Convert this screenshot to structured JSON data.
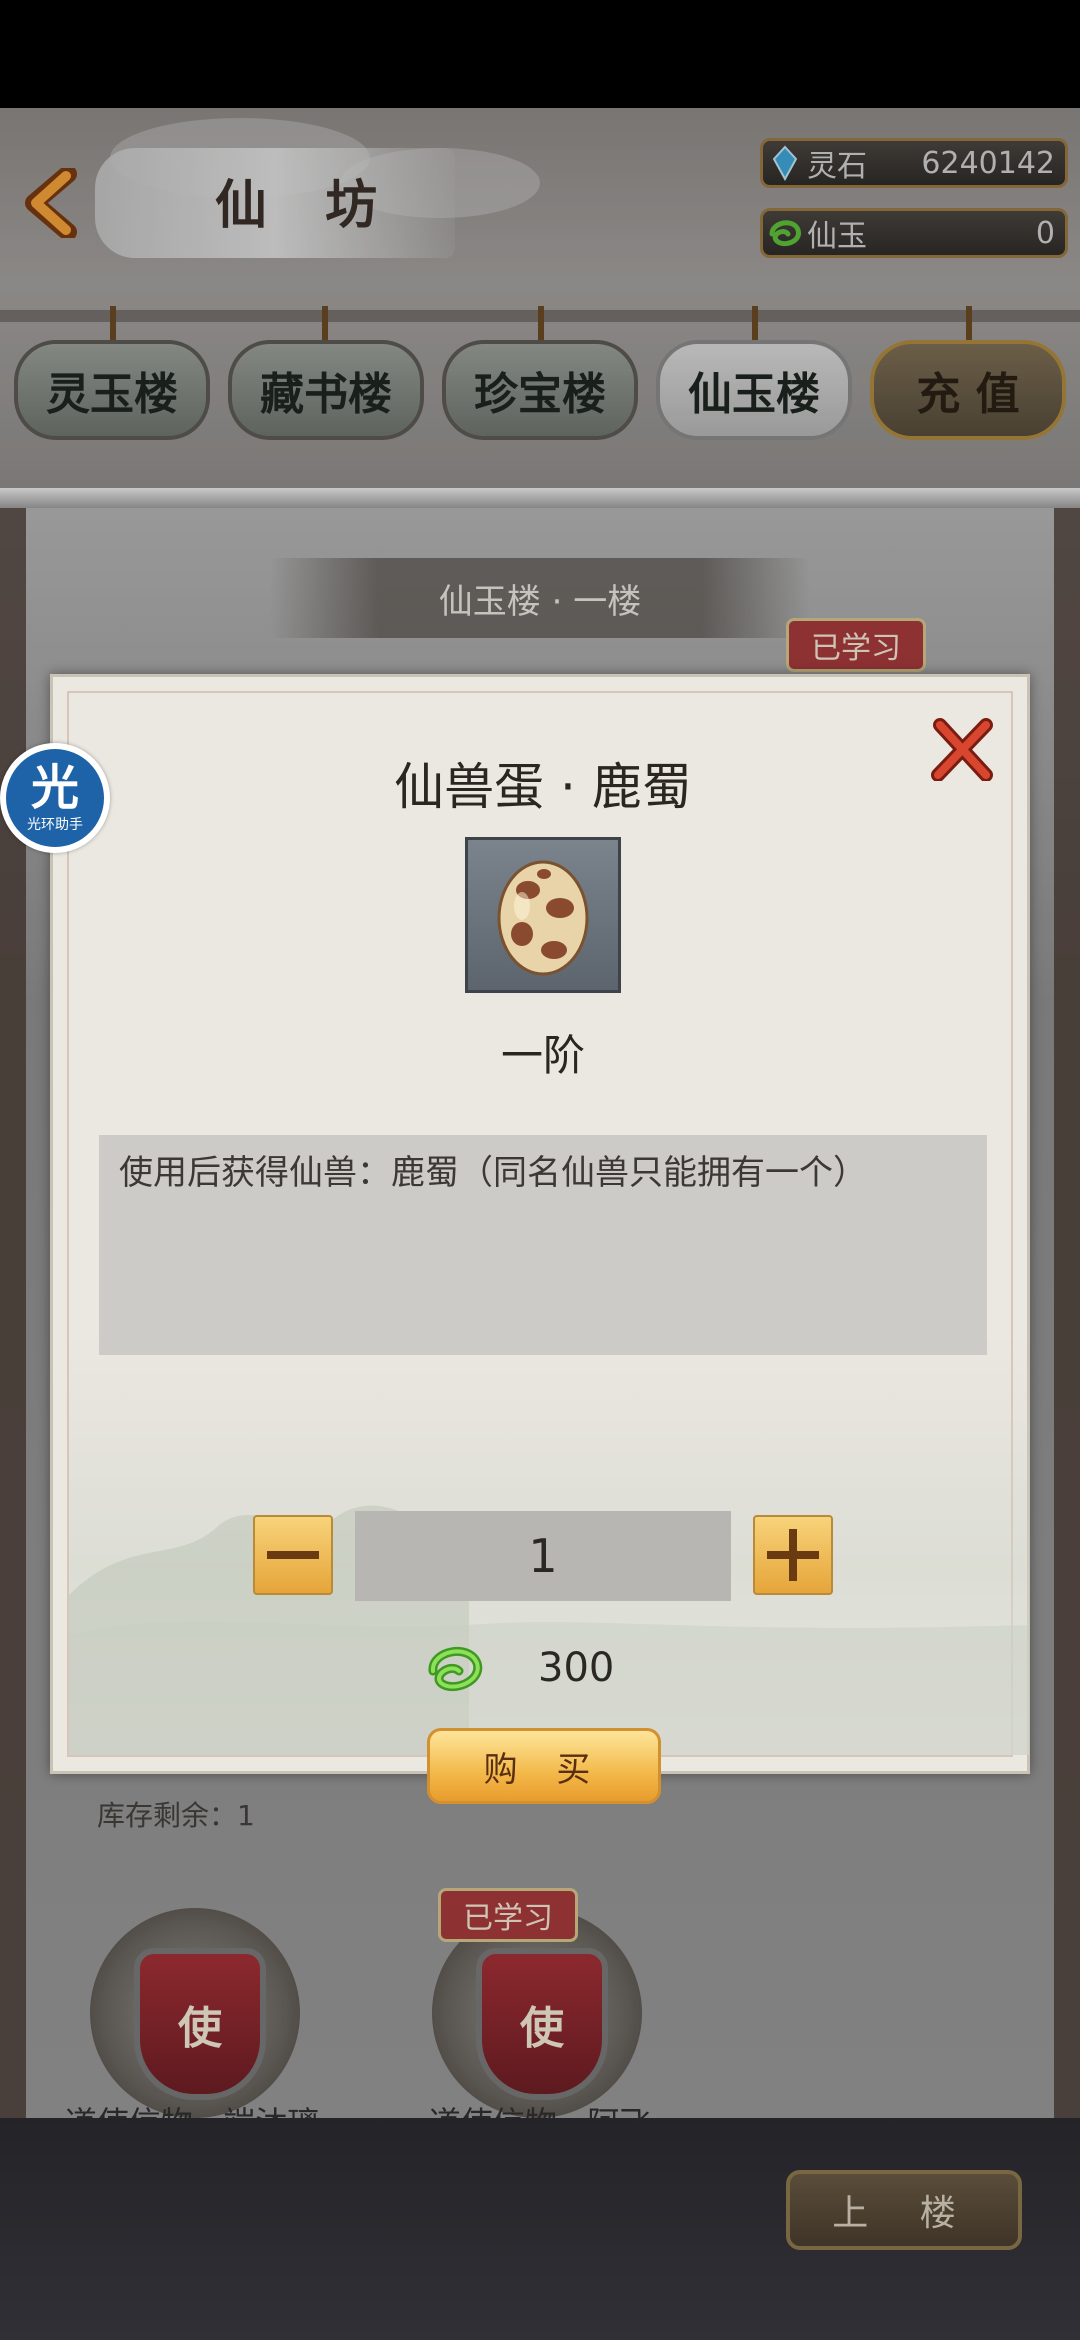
{
  "header": {
    "title": "仙 坊",
    "currencies": [
      {
        "icon": "spirit-stone-icon",
        "name": "灵石",
        "value": "6240142"
      },
      {
        "icon": "immortal-jade-icon",
        "name": "仙玉",
        "value": "0"
      }
    ],
    "tabs": [
      {
        "label": "灵玉楼"
      },
      {
        "label": "藏书楼"
      },
      {
        "label": "珍宝楼"
      },
      {
        "label": "仙玉楼"
      },
      {
        "label": "充 值"
      }
    ]
  },
  "background": {
    "floor_title": "仙玉楼 · 一楼",
    "learned_label": "已学习",
    "items": [
      {
        "name": "道使信物 · 端沐璃",
        "badge": "使"
      },
      {
        "name": "道使信物 · 阿飞",
        "badge": "使"
      }
    ],
    "upstairs_label": "上 楼"
  },
  "modal": {
    "title": "仙兽蛋 · 鹿蜀",
    "tier": "一阶",
    "description": "使用后获得仙兽：鹿蜀（同名仙兽只能拥有一个）",
    "quantity": "1",
    "price": "300",
    "buy_label": "购 买",
    "stock": "库存剩余：1"
  },
  "helper": {
    "char": "光",
    "label": "光环助手"
  },
  "colors": {
    "accent_gold": "#f3b94a",
    "badge_red": "#a53037",
    "close_red": "#d9462f"
  }
}
